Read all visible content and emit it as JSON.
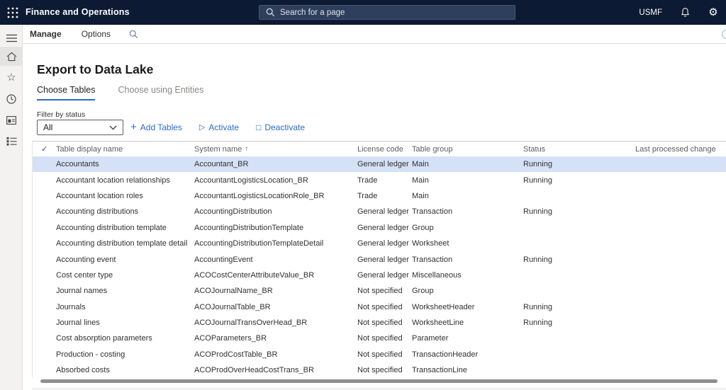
{
  "app": {
    "topbar": {
      "title": "Finance and Operations",
      "search_placeholder": "Search for a page",
      "company": "USMF"
    },
    "action_bar": {
      "items": [
        "Manage",
        "Options"
      ]
    }
  },
  "page": {
    "title": "Export to Data Lake",
    "tabs": [
      {
        "label": "Choose Tables",
        "active": true
      },
      {
        "label": "Choose using Entities",
        "active": false
      }
    ],
    "filter": {
      "label": "Filter by status",
      "value": "All"
    },
    "actions": [
      {
        "label": "Add Tables",
        "icon": "plus-icon"
      },
      {
        "label": "Activate",
        "icon": "play-outline-icon"
      },
      {
        "label": "Deactivate",
        "icon": "square-outline-icon"
      }
    ]
  },
  "grid": {
    "columns": [
      "Table display name",
      "System name",
      "License code",
      "Table group",
      "Status",
      "Last processed change"
    ],
    "sorted_by": {
      "column": "System name",
      "direction": "ascending"
    },
    "selected_row_index": 0,
    "rows": [
      [
        "Accountants",
        "Accountant_BR",
        "General ledger",
        "Main",
        "Running",
        ""
      ],
      [
        "Accountant location relationships",
        "AccountantLogisticsLocation_BR",
        "Trade",
        "Main",
        "Running",
        ""
      ],
      [
        "Accountant location roles",
        "AccountantLogisticsLocationRole_BR",
        "Trade",
        "Main",
        "",
        ""
      ],
      [
        "Accounting distributions",
        "AccountingDistribution",
        "General ledger",
        "Transaction",
        "Running",
        ""
      ],
      [
        "Accounting distribution template",
        "AccountingDistributionTemplate",
        "General ledger",
        "Group",
        "",
        ""
      ],
      [
        "Accounting distribution template detail",
        "AccountingDistributionTemplateDetail",
        "General ledger",
        "Worksheet",
        "",
        ""
      ],
      [
        "Accounting event",
        "AccountingEvent",
        "General ledger",
        "Transaction",
        "Running",
        ""
      ],
      [
        "Cost center type",
        "ACOCostCenterAttributeValue_BR",
        "General ledger",
        "Miscellaneous",
        "",
        ""
      ],
      [
        "Journal names",
        "ACOJournalName_BR",
        "Not specified",
        "Group",
        "",
        ""
      ],
      [
        "Journals",
        "ACOJournalTable_BR",
        "Not specified",
        "WorksheetHeader",
        "Running",
        ""
      ],
      [
        "Journal lines",
        "ACOJournalTransOverHead_BR",
        "Not specified",
        "WorksheetLine",
        "Running",
        ""
      ],
      [
        "Cost absorption parameters",
        "ACOParameters_BR",
        "Not specified",
        "Parameter",
        "",
        ""
      ],
      [
        "Production - costing",
        "ACOProdCostTable_BR",
        "Not specified",
        "TransactionHeader",
        "",
        ""
      ],
      [
        "Absorbed costs",
        "ACOProdOverHeadCostTrans_BR",
        "Not specified",
        "TransactionLine",
        "",
        ""
      ]
    ]
  },
  "colors": {
    "topbar_bg": "#0c1a33",
    "accent_blue": "#2b6bc8",
    "selected_row_bg": "#d5e1f7",
    "sidebar_bg": "#f3f2f1"
  }
}
